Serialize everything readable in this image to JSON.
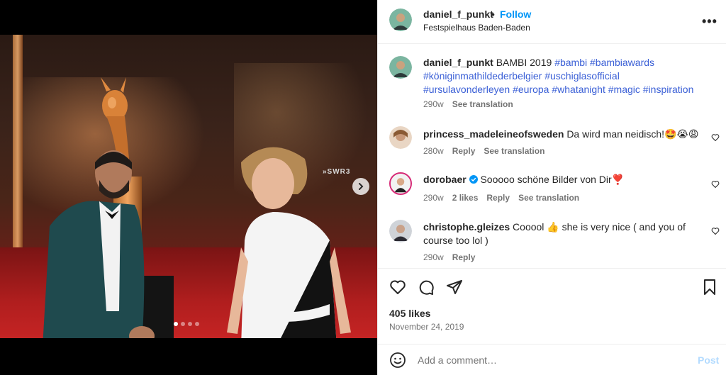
{
  "post": {
    "username": "daniel_f_punkt",
    "bullet": "•",
    "follow_label": "Follow",
    "location": "Festspielhaus Baden-Baden",
    "more_label": "•••"
  },
  "caption": {
    "username": "daniel_f_punkt",
    "text": "BAMBI 2019",
    "hashtags_line1": "#bambi #bambiawards",
    "hashtags_line2": "#königinmathildederbelgier #uschiglasofficial",
    "hashtags_line3": "#ursulavonderleyen #europa #whatanight #magic #inspiration",
    "time": "290w",
    "see_translation": "See translation"
  },
  "comments": [
    {
      "username": "princess_madeleineofsweden",
      "text": "Da wird man neidisch!🤩😭😩",
      "time": "280w",
      "reply": "Reply",
      "see_translation": "See translation"
    },
    {
      "username": "dorobaer",
      "text": "Sooooo schöne Bilder von Dir❣️",
      "time": "290w",
      "likes": "2 likes",
      "reply": "Reply",
      "see_translation": "See translation"
    },
    {
      "username": "christophe.gleizes",
      "text": "Cooool 👍 she is very nice ( and you of course too lol )",
      "time": "290w",
      "reply": "Reply"
    }
  ],
  "footer": {
    "likes": "405 likes",
    "date": "November 24, 2019",
    "comment_placeholder": "Add a comment…",
    "post_label": "Post"
  },
  "photo": {
    "sign_text": "»SWR3"
  },
  "colors": {
    "link_blue": "#0095f6",
    "hashtag_blue": "#3a5fd6",
    "muted": "#737373",
    "post_disabled": "#b3dbff"
  },
  "icons": {
    "like": "heart-icon",
    "comment": "comment-bubble-icon",
    "share": "paper-plane-icon",
    "save": "bookmark-icon",
    "emoji": "smiley-icon",
    "next": "chevron-right-icon",
    "more": "more-options-icon"
  },
  "carousel": {
    "slide_count": 4,
    "active_index": 0
  }
}
